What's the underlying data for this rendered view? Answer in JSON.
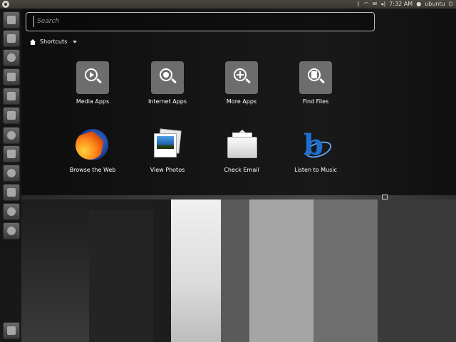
{
  "top_panel": {
    "logo_icon": "ubuntu-logo-icon",
    "tray_icons": [
      "bluetooth-icon",
      "network-icon",
      "mail-icon",
      "volume-icon"
    ],
    "clock": "7:32 AM",
    "user": "ubuntu",
    "power_icon": "power-icon"
  },
  "dash": {
    "search_placeholder": "Search",
    "section_label": "Shortcuts",
    "shortcuts": [
      {
        "label": "Media Apps",
        "icon": "media-apps-lens-icon"
      },
      {
        "label": "Internet Apps",
        "icon": "internet-apps-lens-icon"
      },
      {
        "label": "More Apps",
        "icon": "more-apps-lens-icon"
      },
      {
        "label": "Find Files",
        "icon": "find-files-lens-icon"
      }
    ],
    "apps": [
      {
        "label": "Browse the Web",
        "icon": "firefox-icon"
      },
      {
        "label": "View Photos",
        "icon": "photos-icon"
      },
      {
        "label": "Check Email",
        "icon": "email-icon"
      },
      {
        "label": "Listen to Music",
        "icon": "music-icon"
      }
    ]
  },
  "launcher": {
    "items": [
      "dash-icon",
      "home-folder-icon",
      "firefox-icon",
      "document-icon",
      "spreadsheet-icon",
      "presentation-icon",
      "settings-icon",
      "trash-icon",
      "camera-icon",
      "terminal-icon",
      "apps-lens-icon",
      "files-lens-icon",
      "workspace-icon"
    ]
  }
}
